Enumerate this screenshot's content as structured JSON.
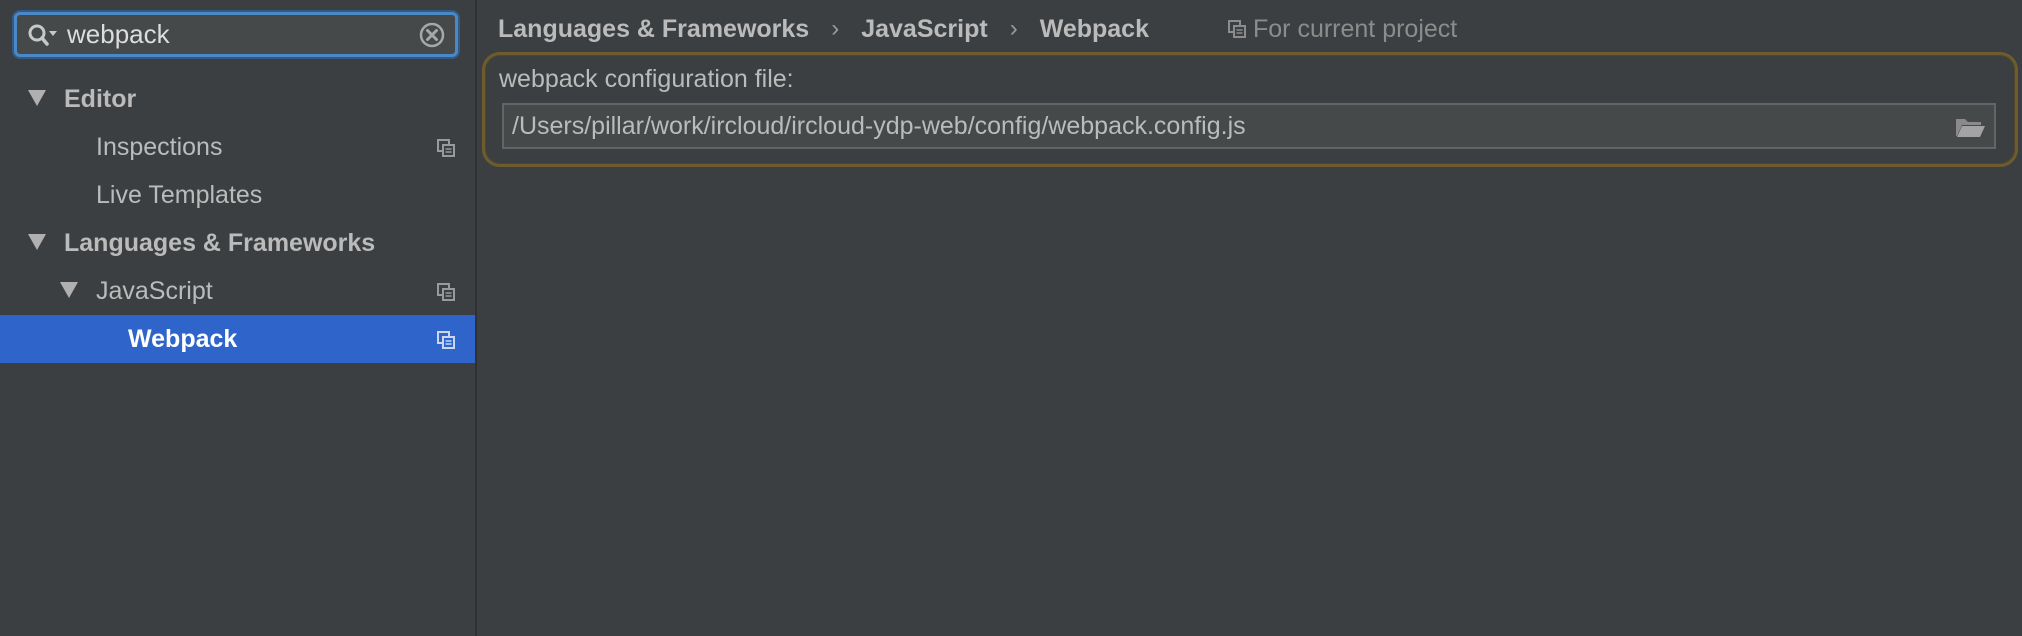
{
  "search": {
    "value": "webpack",
    "icon": "search-icon",
    "clear_icon": "clear-icon"
  },
  "tree": {
    "items": [
      {
        "label": "Editor",
        "bold": true,
        "expanded": true,
        "has_project_icon": false,
        "selected": false
      },
      {
        "label": "Inspections",
        "bold": false,
        "expanded": false,
        "has_project_icon": true,
        "selected": false
      },
      {
        "label": "Live Templates",
        "bold": false,
        "expanded": false,
        "has_project_icon": false,
        "selected": false
      },
      {
        "label": "Languages & Frameworks",
        "bold": true,
        "expanded": true,
        "has_project_icon": false,
        "selected": false
      },
      {
        "label": "JavaScript",
        "bold": false,
        "expanded": true,
        "has_project_icon": true,
        "selected": false
      },
      {
        "label": "Webpack",
        "bold": true,
        "expanded": false,
        "has_project_icon": true,
        "selected": true
      }
    ]
  },
  "breadcrumb": {
    "items": [
      "Languages & Frameworks",
      "JavaScript",
      "Webpack"
    ],
    "separator": "›",
    "scope_label": "For current project"
  },
  "config": {
    "label": "webpack configuration file:",
    "path": "/Users/pillar/work/ircloud/ircloud-ydp-web/config/webpack.config.js",
    "browse_icon": "folder-icon"
  },
  "colors": {
    "background": "#3c3f41",
    "selection": "#2f65ca",
    "focus_ring": "#4a88c7",
    "highlight_border": "#6e5d2c"
  }
}
